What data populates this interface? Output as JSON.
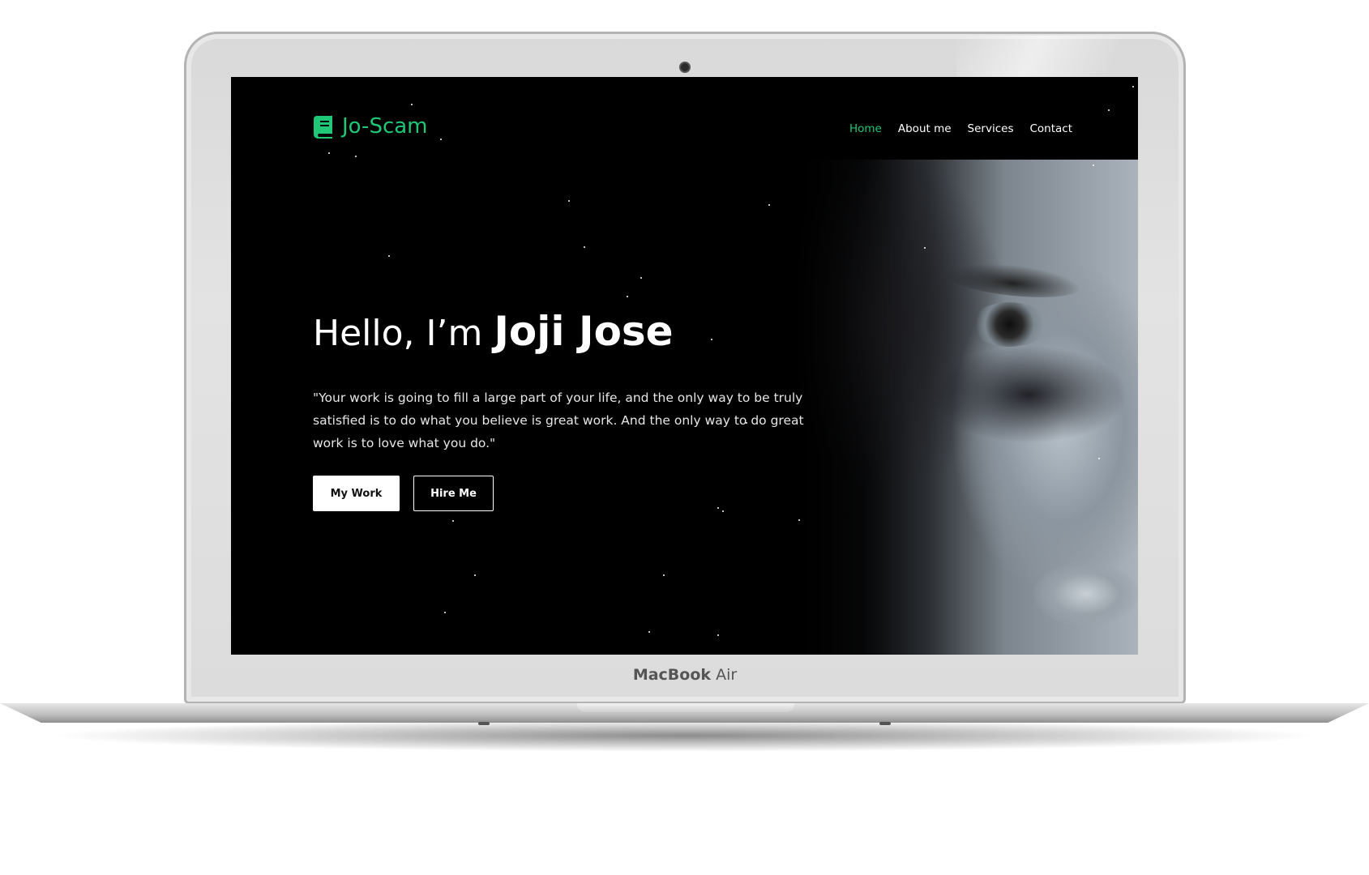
{
  "device": {
    "brand_label_bold": "MacBook",
    "brand_label_light": " Air"
  },
  "site": {
    "logo_text": "Jo-Scam",
    "logo_icon": "book-icon",
    "accent_color": "#1fc777"
  },
  "nav": {
    "items": [
      {
        "label": "Home",
        "active": true
      },
      {
        "label": "About me",
        "active": false
      },
      {
        "label": "Services",
        "active": false
      },
      {
        "label": "Contact",
        "active": false
      }
    ]
  },
  "hero": {
    "greeting": "Hello, I’m",
    "name": "Joji Jose",
    "quote": "\"Your work is going to fill a large part of your life, and the only way to be truly satisfied is to do what you believe is great work. And the only way to do great work is to love what you do.\"",
    "primary_button": "My Work",
    "secondary_button": "Hire Me"
  }
}
